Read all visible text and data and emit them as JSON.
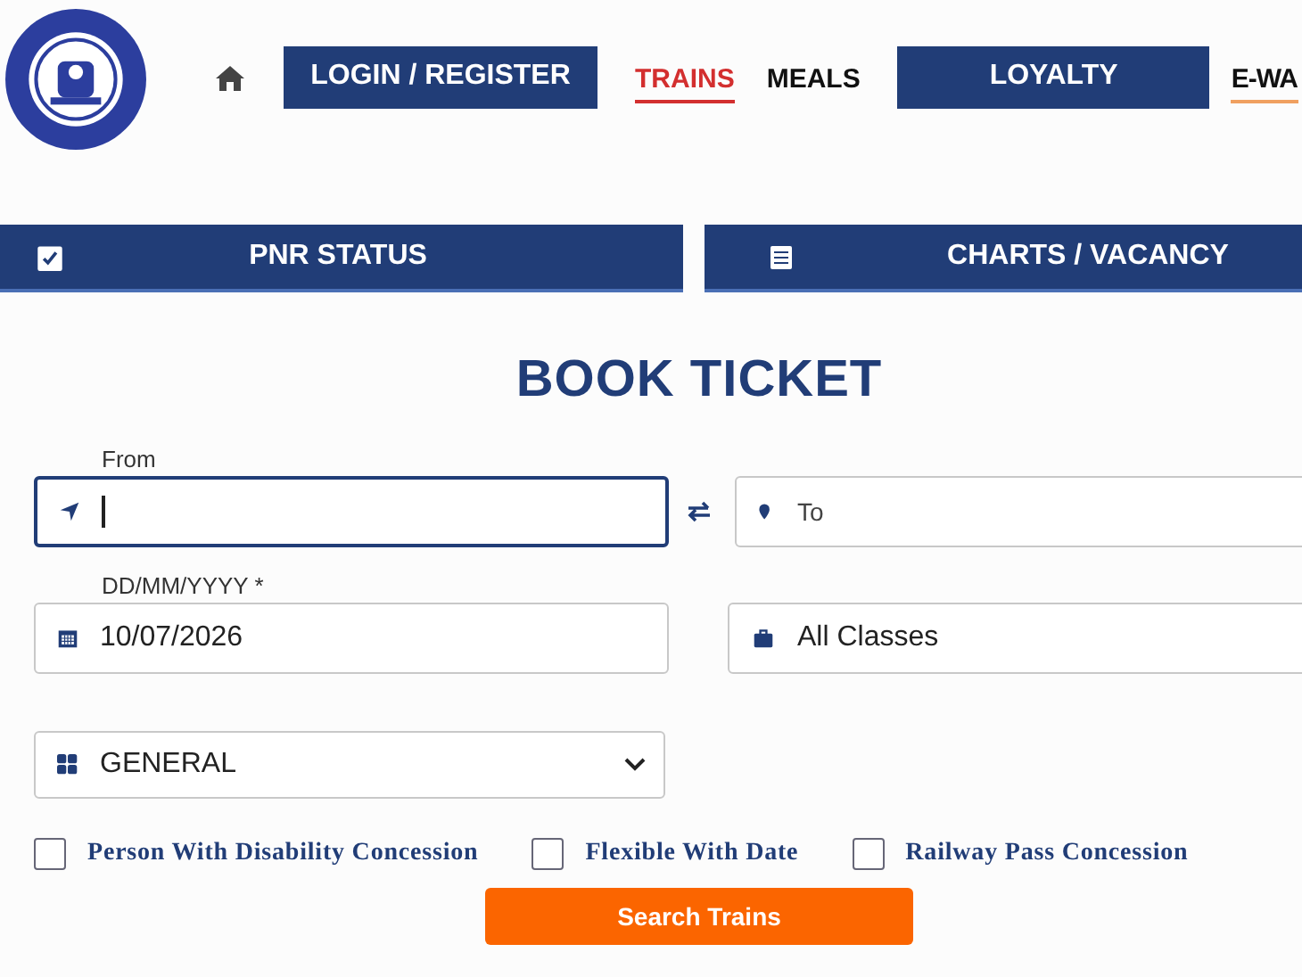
{
  "nav": [
    {
      "kind": "home"
    },
    {
      "kind": "button",
      "label": "LOGIN / REGISTER"
    },
    {
      "kind": "link",
      "label": "TRAINS",
      "selected": true
    },
    {
      "kind": "link",
      "label": "MEALS",
      "selected": false
    },
    {
      "kind": "button",
      "label": "LOYALTY"
    },
    {
      "kind": "link",
      "label": "E-WA",
      "selected": false,
      "underline": true
    }
  ],
  "quick_tabs": [
    {
      "kind": "pnr",
      "label": "PNR STATUS"
    },
    {
      "kind": "charts",
      "label": "CHARTS / VACANCY"
    }
  ],
  "title": "BOOK TICKET",
  "from": {
    "label": "From",
    "focused": true
  },
  "to": {
    "placeholder": "To"
  },
  "date": {
    "label": "DD/MM/YYYY *",
    "value": "10/07/2026"
  },
  "class": {
    "value": "All Classes"
  },
  "quota": {
    "value": "GENERAL"
  },
  "options": [
    {
      "label": "Person With Disability Concession",
      "checked": false
    },
    {
      "label": "Flexible With Date",
      "checked": false
    },
    {
      "label": "Railway Pass Concession",
      "checked": false
    }
  ],
  "search_button": "Search Trains"
}
